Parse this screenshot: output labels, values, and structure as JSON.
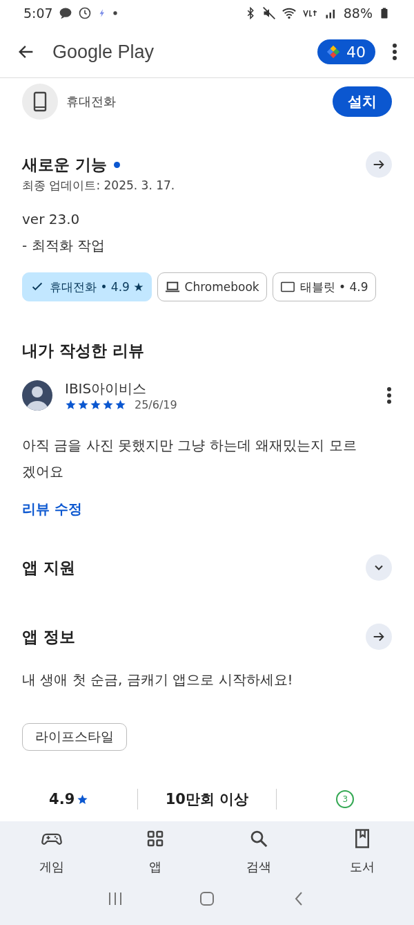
{
  "status_bar": {
    "time": "5:07",
    "battery": "88%"
  },
  "app_bar": {
    "title": "Google Play",
    "points": "40"
  },
  "device": {
    "type": "휴대전화",
    "install": "설치"
  },
  "whats_new": {
    "title": "새로운 기능",
    "new_dot": true,
    "updated": "최종 업데이트: 2025. 3. 17.",
    "version": "ver 23.0",
    "notes": "- 최적화 작업"
  },
  "device_chips": [
    {
      "kind": "phone",
      "label": "휴대전화 • 4.9 ★",
      "selected": true
    },
    {
      "kind": "laptop",
      "label": "Chromebook",
      "selected": false
    },
    {
      "kind": "tablet",
      "label": "태블릿 • 4.9",
      "selected": false
    }
  ],
  "my_review": {
    "heading": "내가 작성한 리뷰",
    "author": "IBIS아이비스",
    "stars": 5,
    "date": "25/6/19",
    "text": "아직 금을 사진 못했지만 그냥 하는데 왜재밌는지 모르겠어요",
    "edit": "리뷰 수정"
  },
  "app_support": {
    "title": "앱 지원",
    "expanded": false
  },
  "app_info": {
    "title": "앱 정보",
    "description": "내 생애 첫 순금, 금캐기 앱으로 시작하세요!",
    "tag": "라이프스타일"
  },
  "stats": [
    {
      "kind": "rating",
      "value": "4.9"
    },
    {
      "kind": "downloads",
      "value": "10만회 이상"
    },
    {
      "kind": "age",
      "value": "3"
    }
  ],
  "bottom_nav": [
    {
      "kind": "games",
      "label": "게임",
      "selected": false
    },
    {
      "kind": "apps",
      "label": "앱",
      "selected": false
    },
    {
      "kind": "search",
      "label": "검색",
      "selected": false
    },
    {
      "kind": "books",
      "label": "도서",
      "selected": false
    }
  ]
}
